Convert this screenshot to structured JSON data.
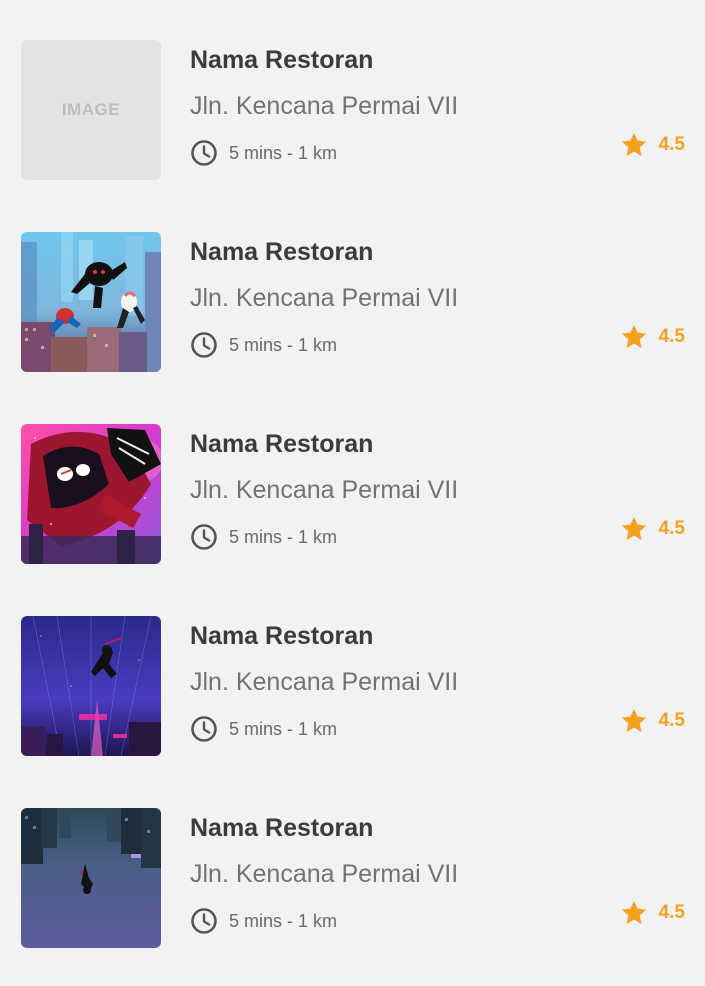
{
  "restaurants": [
    {
      "name": "Nama Restoran",
      "address": "Jln. Kencana Permai VII",
      "time": "5 mins - 1 km",
      "rating": "4.5",
      "image_label": "IMAGE"
    },
    {
      "name": "Nama Restoran",
      "address": "Jln. Kencana Permai VII",
      "time": "5 mins - 1 km",
      "rating": "4.5"
    },
    {
      "name": "Nama Restoran",
      "address": "Jln. Kencana Permai VII",
      "time": "5 mins - 1 km",
      "rating": "4.5"
    },
    {
      "name": "Nama Restoran",
      "address": "Jln. Kencana Permai VII",
      "time": "5 mins - 1 km",
      "rating": "4.5"
    },
    {
      "name": "Nama Restoran",
      "address": "Jln. Kencana Permai VII",
      "time": "5 mins - 1 km",
      "rating": "4.5"
    }
  ],
  "icons": {
    "time": "clock-icon",
    "rating": "star-icon"
  },
  "colors": {
    "rating": "#f7a021",
    "title": "#3b3b3b",
    "address": "#737373",
    "background": "#f2f2f2"
  }
}
